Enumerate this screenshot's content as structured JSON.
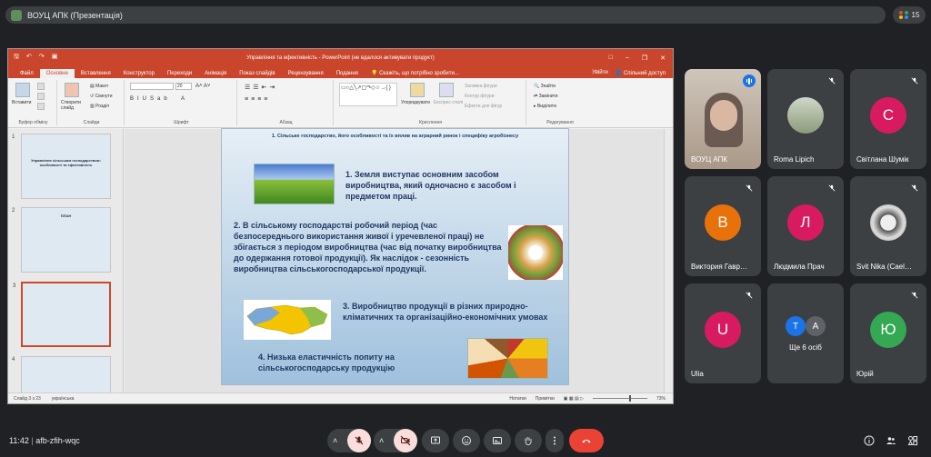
{
  "meet": {
    "window_title": "ВОУЦ АПК (Презентація)",
    "participant_count": "15",
    "time": "11:42",
    "meeting_code": "afb-zfih-wqc"
  },
  "ppt": {
    "title": "Управління та ефективність - PowerPoint (не вдалося активувати продукт)",
    "tabs": [
      "Файл",
      "Основне",
      "Вставлення",
      "Конструктор",
      "Переходи",
      "Анімація",
      "Показ слайдів",
      "Рецензування",
      "Подання"
    ],
    "active_tab": "Основне",
    "tell_me": "Скажіть, що потрібно зробити...",
    "signin": "Увійти",
    "share": "Спільний доступ",
    "ribbon": {
      "paste": "Вставити",
      "clipboard": "Буфер обміну",
      "new_slide": "Створити слайд",
      "layout": "Макет",
      "reset": "Скинути",
      "section": "Розділ",
      "slides": "Слайди",
      "font_size": "20",
      "font": "Шрифт",
      "paragraph": "Абзац",
      "arrange": "Упорядкувати",
      "quick_styles": "Експрес-стилі",
      "shape_fill": "Заливка фігури",
      "shape_outline": "Контур фігури",
      "shape_effects": "Ефекти для фігур",
      "drawing": "Креслення",
      "find": "Знайти",
      "replace": "Замінити",
      "select": "Виділити",
      "editing": "Редагування"
    },
    "thumbnails": [
      {
        "num": "1",
        "title": "Управління сільським господарством: особливості та ефективність"
      },
      {
        "num": "2",
        "title": "ПЛАН"
      },
      {
        "num": "3",
        "title": ""
      },
      {
        "num": "4",
        "title": ""
      }
    ],
    "status": {
      "slide": "Слайд 3 з 23",
      "lang": "українська",
      "notes": "Нотатки",
      "comments": "Примітки",
      "zoom": "73%"
    }
  },
  "slide": {
    "header": "1. Сільське господарство, його особливості та їх вплив на аграрний ринок і специфіку агробізнесу",
    "p1": "1. Земля виступає основним засобом виробництва, який одночасно є засобом і предметом праці.",
    "p2": "2. В сільському господарстві робочий період (час безпосереднього використання живої і уречевленої праці) не збігається з періодом виробництва (час від початку виробництва до одержання готової продукції). Як наслідок - сезонність виробництва сільськогосподарської продукції.",
    "p3": "3. Виробництво продукції в різних природно-кліматичних та організаційно-економічних умовах",
    "p4": "4. Низька еластичність попиту на сільськогосподарську продукцію"
  },
  "participants": [
    {
      "name": "ВОУЦ АПК",
      "type": "video",
      "speaking": true
    },
    {
      "name": "Roma Lipich",
      "type": "photo",
      "muted": true
    },
    {
      "name": "Світлана Шумік",
      "initial": "С",
      "color": "#d81b60",
      "muted": true
    },
    {
      "name": "Виктория Гавр…",
      "initial": "В",
      "color": "#e8710a",
      "muted": true
    },
    {
      "name": "Людмила Прач",
      "initial": "Л",
      "color": "#d81b60",
      "muted": true
    },
    {
      "name": "Svit Nika (Cael…",
      "type": "photo",
      "muted": true
    },
    {
      "name": "Ulia",
      "initial": "U",
      "color": "#d81b60",
      "muted": true
    },
    {
      "name": "Ще 6 осіб",
      "type": "group",
      "initials": [
        "T",
        "A"
      ]
    },
    {
      "name": "Юрій",
      "initial": "Ю",
      "color": "#34a853",
      "muted": true
    }
  ]
}
